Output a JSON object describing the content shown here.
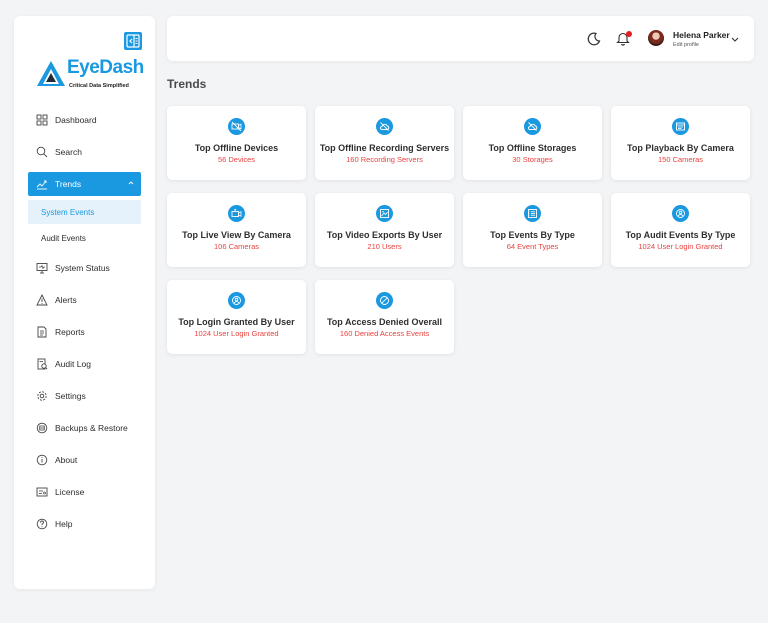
{
  "brand": {
    "name": "EyeDash",
    "tagline": "Critical Data Simplified",
    "accent": "#1a98e0"
  },
  "sidebar": {
    "items": [
      {
        "label": "Dashboard",
        "icon": "grid-icon"
      },
      {
        "label": "Search",
        "icon": "search-icon"
      },
      {
        "label": "Trends",
        "icon": "trend-chart-icon",
        "active": true,
        "children": [
          {
            "label": "System Events",
            "selected": true
          },
          {
            "label": "Audit Events"
          }
        ]
      },
      {
        "label": "System Status",
        "icon": "monitor-icon"
      },
      {
        "label": "Alerts",
        "icon": "warning-icon"
      },
      {
        "label": "Reports",
        "icon": "report-icon"
      },
      {
        "label": "Audit Log",
        "icon": "audit-icon"
      },
      {
        "label": "Settings",
        "icon": "gear-icon"
      },
      {
        "label": "Backups & Restore",
        "icon": "backup-icon"
      },
      {
        "label": "About",
        "icon": "info-icon"
      },
      {
        "label": "License",
        "icon": "license-icon"
      },
      {
        "label": "Help",
        "icon": "help-icon"
      }
    ]
  },
  "header": {
    "user_name": "Helena Parker",
    "user_link": "Edit profile",
    "notification_color": "#e32020"
  },
  "page": {
    "title": "Trends"
  },
  "cards": [
    {
      "title": "Top Offline Devices",
      "subtitle": "56 Devices",
      "icon": "camera-off-icon"
    },
    {
      "title": "Top Offline Recording Servers",
      "subtitle": "160 Recording Servers",
      "icon": "cloud-off-icon"
    },
    {
      "title": "Top Offline Storages",
      "subtitle": "30 Storages",
      "icon": "storage-off-icon"
    },
    {
      "title": "Top Playback By Camera",
      "subtitle": "150 Cameras",
      "icon": "playback-icon"
    },
    {
      "title": "Top Live View By Camera",
      "subtitle": "106 Cameras",
      "icon": "live-camera-icon"
    },
    {
      "title": "Top Video Exports By User",
      "subtitle": "210 Users",
      "icon": "video-export-icon"
    },
    {
      "title": "Top Events By Type",
      "subtitle": "64 Event Types",
      "icon": "list-icon"
    },
    {
      "title": "Top Audit Events By Type",
      "subtitle": "1024 User Login Granted",
      "icon": "audit-badge-icon"
    },
    {
      "title": "Top Login Granted By User",
      "subtitle": "1024 User Login Granted",
      "icon": "login-badge-icon"
    },
    {
      "title": "Top Access Denied Overall",
      "subtitle": "160 Denied Access Events",
      "icon": "access-denied-icon"
    }
  ]
}
